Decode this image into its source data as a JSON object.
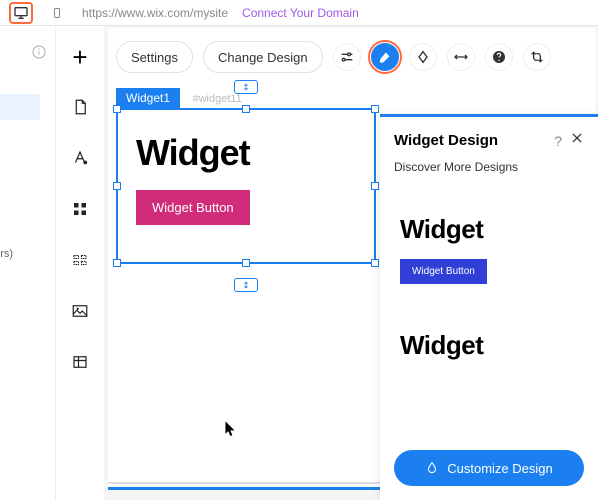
{
  "topbar": {
    "url": "https://www.wix.com/mysite",
    "connect": "Connect Your Domain"
  },
  "farleft": {
    "caption": "pers)"
  },
  "toolbar": {
    "settings": "Settings",
    "change_design": "Change Design"
  },
  "selection": {
    "tab": "Widget1",
    "id": "#widget11",
    "title": "Widget",
    "button": "Widget Button"
  },
  "panel": {
    "title": "Widget Design",
    "subtitle": "Discover More Designs",
    "designs": [
      {
        "title": "Widget",
        "button": "Widget Button"
      },
      {
        "title": "Widget"
      }
    ],
    "customize": "Customize Design"
  }
}
